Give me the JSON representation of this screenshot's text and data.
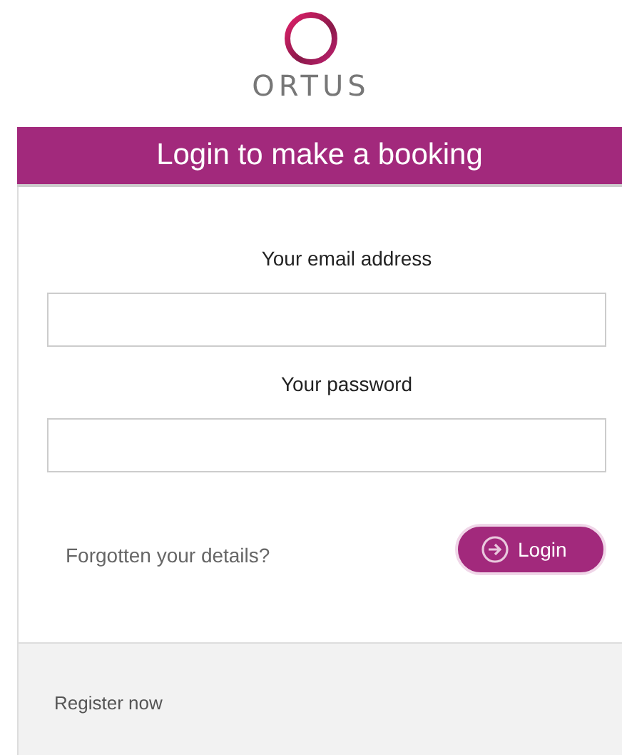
{
  "logo": {
    "text": "ORTUS"
  },
  "header": {
    "title": "Login to make a booking"
  },
  "form": {
    "fields": [
      {
        "label": "Your email address"
      },
      {
        "label": "Your password"
      }
    ],
    "forgot_link": "Forgotten your details?",
    "login_button": "Login"
  },
  "footer": {
    "register_link": "Register now"
  }
}
